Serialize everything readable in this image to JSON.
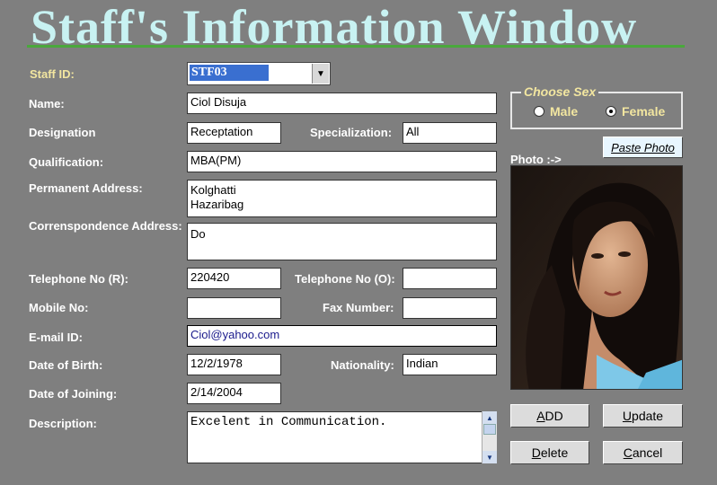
{
  "window": {
    "title": "Staff's  Information Window"
  },
  "labels": {
    "staff_id": "Staff ID:",
    "name": "Name:",
    "designation": "Designation",
    "specialization": "Specialization:",
    "qualification": "Qualification:",
    "permanent_address": "Permanent Address:",
    "correspondence_address": "Correnspondence Address:",
    "tel_r": "Telephone No (R):",
    "tel_o": "Telephone No (O):",
    "mobile": "Mobile No:",
    "fax": "Fax Number:",
    "email": "E-mail ID:",
    "dob": "Date of Birth:",
    "nationality": "Nationality:",
    "doj": "Date of Joining:",
    "description": "Description:",
    "photo": "Photo :->"
  },
  "values": {
    "staff_id": "STF03",
    "name": "Ciol Disuja",
    "designation": "Receptation",
    "specialization": "All",
    "qualification": "MBA(PM)",
    "permanent_address": "Kolghatti\nHazaribag",
    "correspondence_address": "Do",
    "tel_r": "220420",
    "tel_o": "",
    "mobile": "",
    "fax": "",
    "email": "Ciol@yahoo.com",
    "dob": "12/2/1978",
    "nationality": "Indian",
    "doj": "2/14/2004",
    "description": "Excelent in Communication."
  },
  "sex": {
    "legend": "Choose Sex",
    "options": [
      "Male",
      "Female"
    ],
    "selected": "Female"
  },
  "buttons": {
    "paste_photo": "Paste Photo",
    "add_accel": "A",
    "add_rest": "DD",
    "update_accel": "U",
    "update_rest": "pdate",
    "delete_accel": "D",
    "delete_rest": "elete",
    "cancel_accel": "C",
    "cancel_rest": "ancel"
  },
  "icons": {
    "dropdown": "chevron-down-icon",
    "scroll_up": "arrow-up-icon",
    "scroll_down": "arrow-down-icon"
  }
}
